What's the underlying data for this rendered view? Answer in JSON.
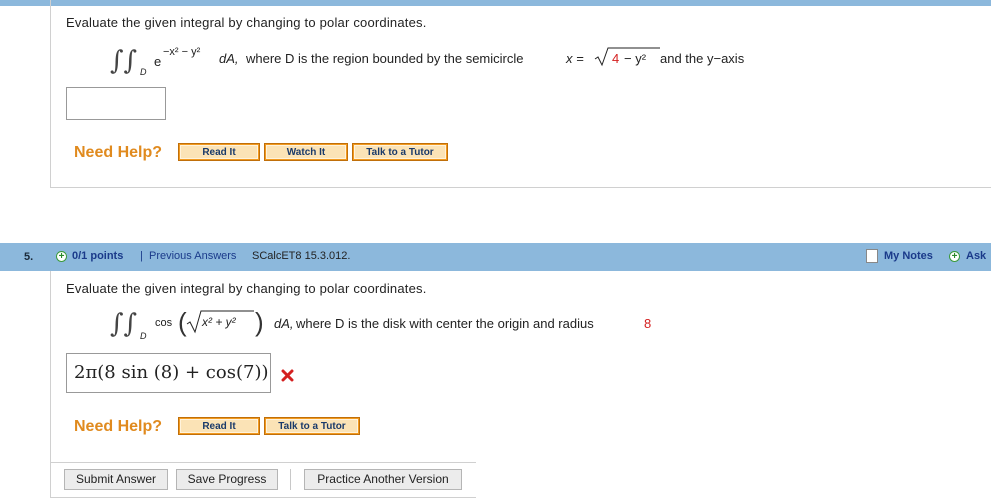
{
  "q4": {
    "prompt": "Evaluate the given integral by changing to polar coordinates.",
    "integrand_base": "e",
    "exponent": "−x² − y²",
    "dA": "dA,",
    "where_text": "where D is the region bounded by the semicircle",
    "x_eq": "x =",
    "radicand_num": "4",
    "radicand_rest": "− y²",
    "tail": "and the y−axis",
    "region": "D",
    "answer_value": "",
    "need_help": "Need Help?",
    "buttons": [
      "Read It",
      "Watch It",
      "Talk to a Tutor"
    ]
  },
  "q5": {
    "number": "5.",
    "points": "0/1 points",
    "separator": "|",
    "previous_answers": "Previous Answers",
    "source": "SCalcET8 15.3.012.",
    "my_notes": "My Notes",
    "ask": "Ask",
    "prompt": "Evaluate the given integral by changing to polar coordinates.",
    "func": "cos",
    "radicand": "x² + y²",
    "dA": "dA,",
    "where_text": "where D is the disk with center the origin and radius",
    "radius": "8",
    "region": "D",
    "answer": "2π(8 sin (8) + cos(7))",
    "need_help": "Need Help?",
    "buttons": [
      "Read It",
      "Talk to a Tutor"
    ],
    "actions": [
      "Submit Answer",
      "Save Progress",
      "Practice Another Version"
    ]
  },
  "colors": {
    "header_bar": "#8cb8dc",
    "help": "#e08a1e",
    "radius_red": "#d42020",
    "wrong_mark": "#d42020"
  }
}
